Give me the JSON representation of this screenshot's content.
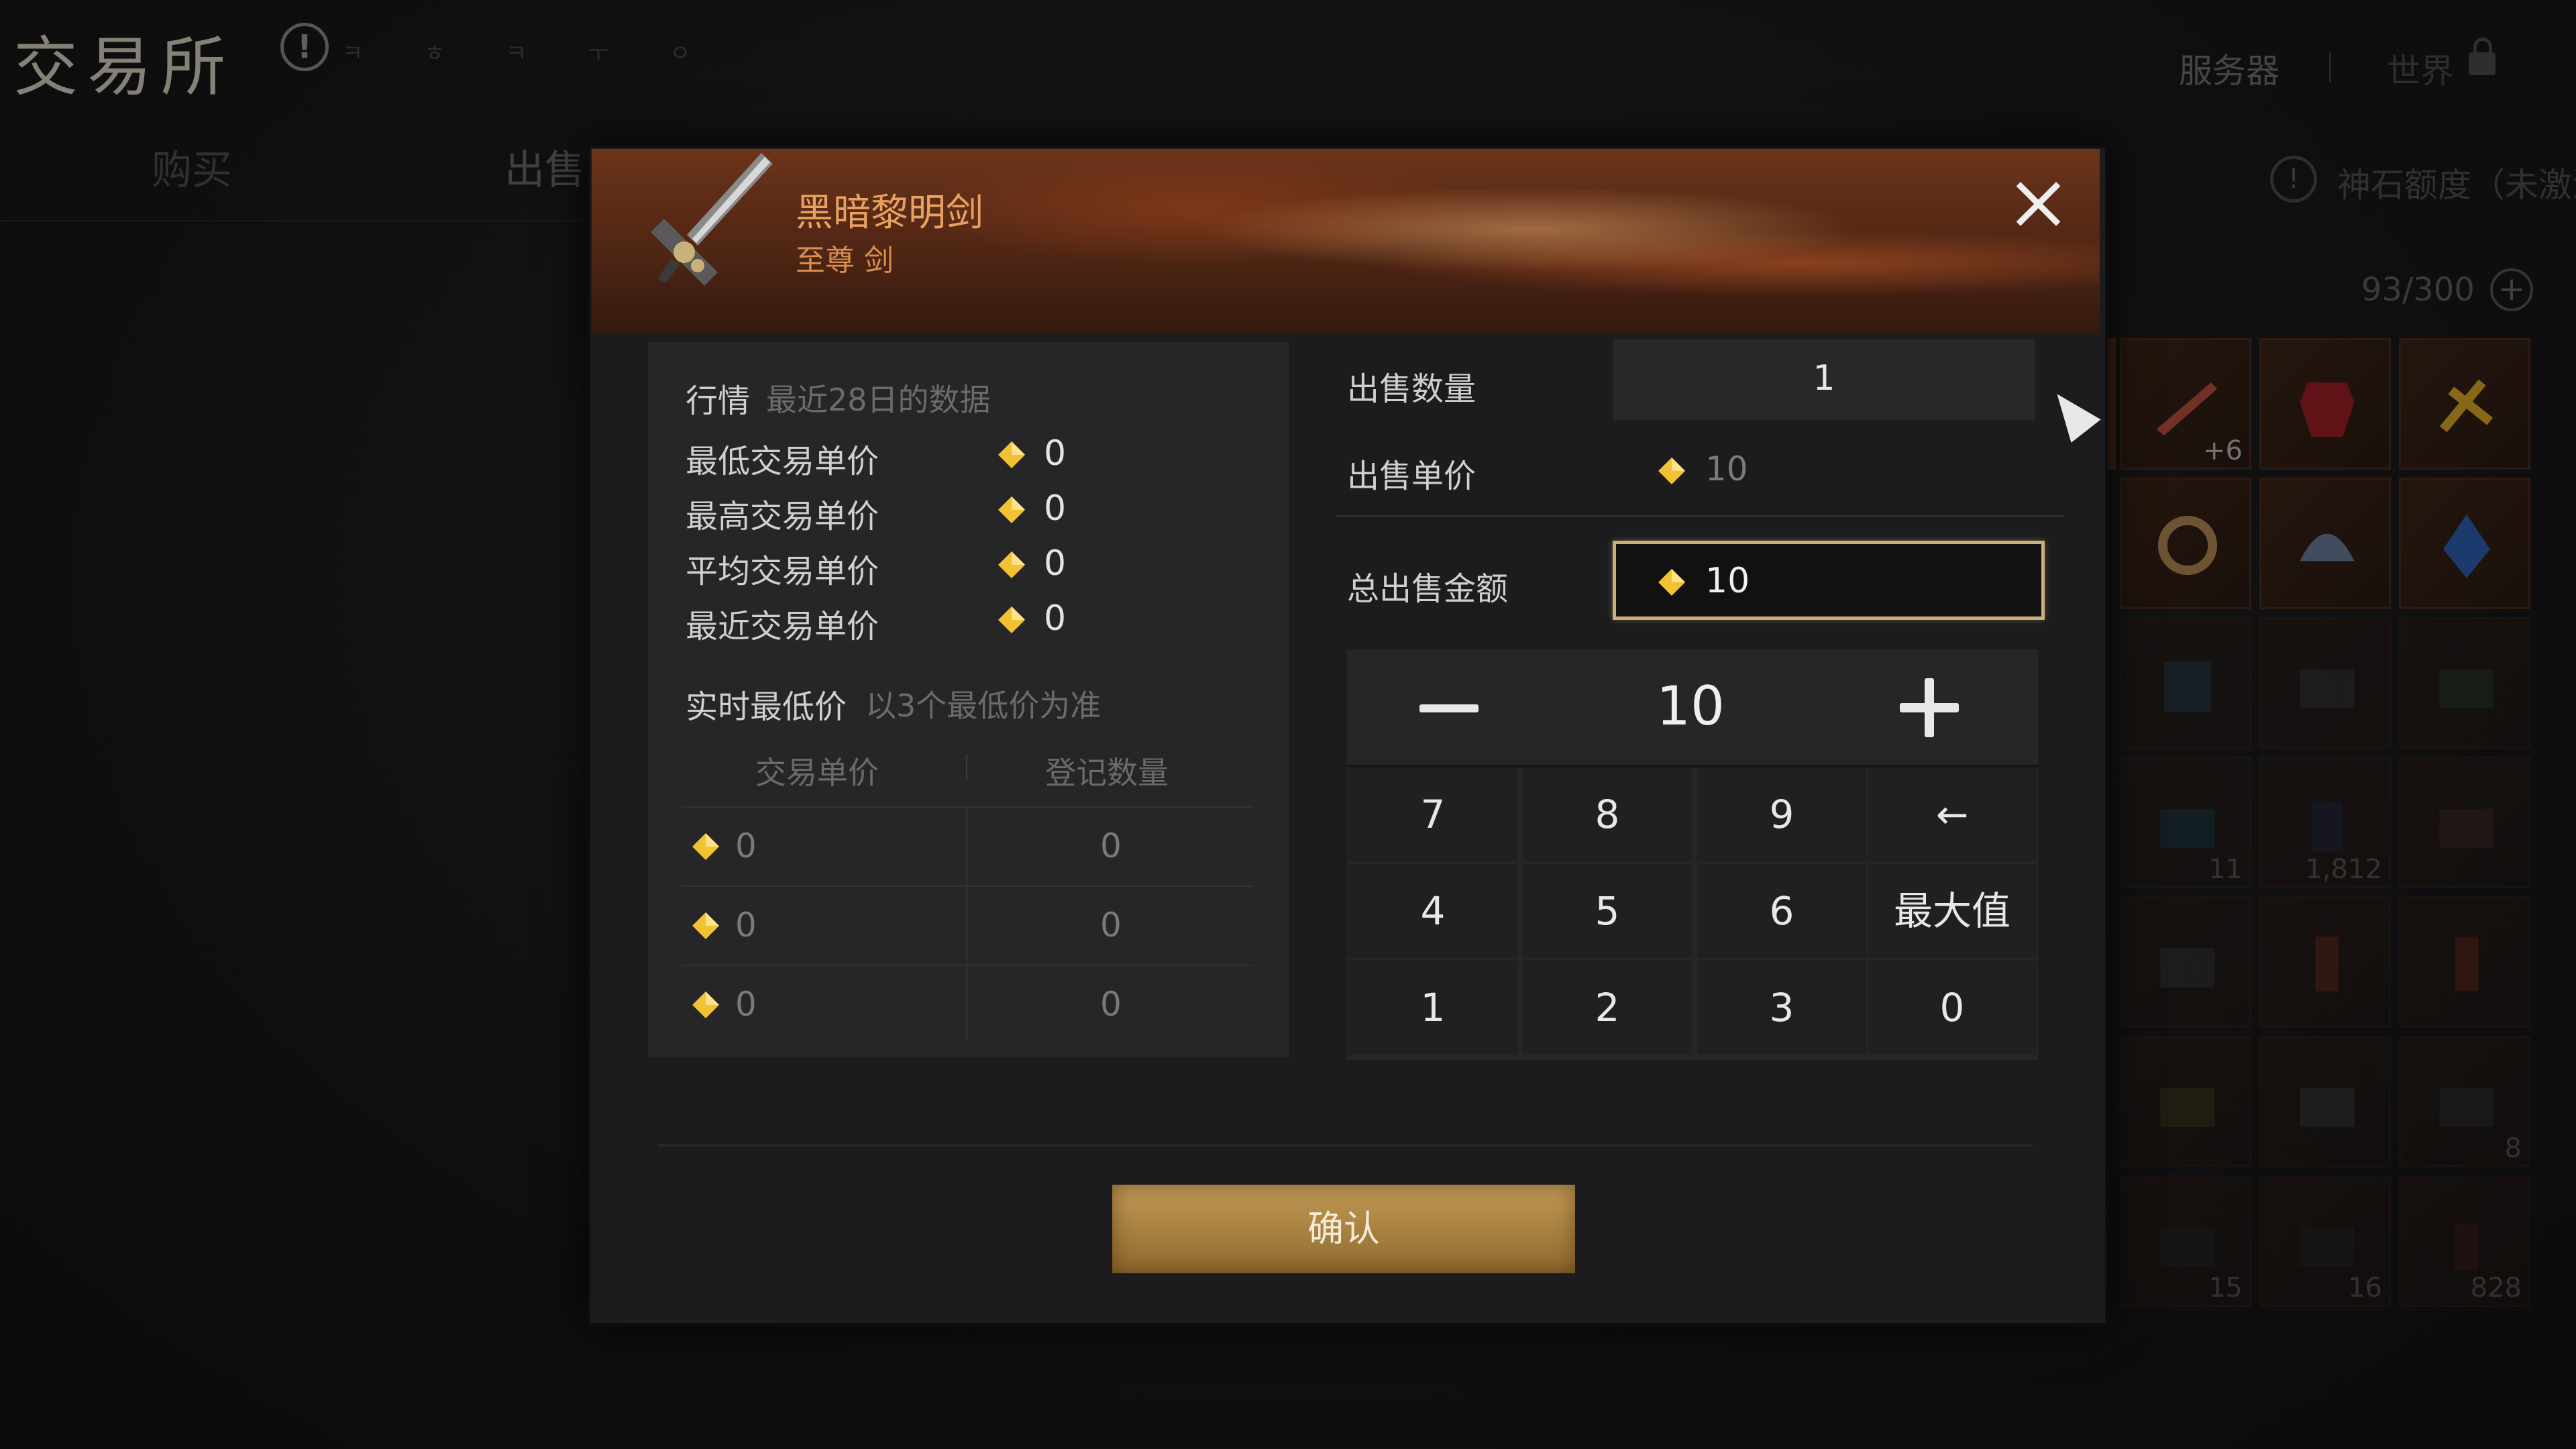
{
  "background": {
    "title": "交易所",
    "hint_text": "ㅋ ㅎ ㅋ ㅜ ㅇ",
    "tabs": {
      "buy": "购买",
      "sell": "出售"
    },
    "header_right": {
      "server": "服务器",
      "world": "世界"
    },
    "shen_quota": "神石额度（未激活",
    "capacity": "93/300",
    "inventory_counts": [
      "+6",
      "",
      "",
      "",
      "",
      "",
      "",
      "",
      "",
      "11",
      "1,812",
      "",
      "",
      "",
      "",
      "",
      "",
      "8",
      "15",
      "16",
      "828"
    ]
  },
  "modal": {
    "item": {
      "name": "黑暗黎明剑",
      "subtitle": "至尊 剑"
    },
    "market": {
      "header": "行情",
      "header_note": "最近28日的数据",
      "rows": [
        {
          "label": "最低交易单价",
          "value": "0"
        },
        {
          "label": "最高交易单价",
          "value": "0"
        },
        {
          "label": "平均交易单价",
          "value": "0"
        },
        {
          "label": "最近交易单价",
          "value": "0"
        }
      ],
      "realtime_title": "实时最低价",
      "realtime_note": "以3个最低价为准",
      "table_headers": [
        "交易单价",
        "登记数量"
      ],
      "table_rows": [
        {
          "price": "0",
          "qty": "0"
        },
        {
          "price": "0",
          "qty": "0"
        },
        {
          "price": "0",
          "qty": "0"
        }
      ]
    },
    "sell": {
      "qty_label": "出售数量",
      "qty_value": "1",
      "unit_price_label": "出售单价",
      "unit_price_value": "10",
      "total_label": "总出售金额",
      "total_value": "10"
    },
    "keypad": {
      "stepper_value": "10",
      "keys": [
        "7",
        "8",
        "9",
        "←",
        "4",
        "5",
        "6",
        "最大值",
        "1",
        "2",
        "3",
        "0"
      ]
    },
    "confirm_label": "确认"
  },
  "colors": {
    "accent_gold": "#c9b07a",
    "header_orange": "#e8a15f",
    "diamond_gold": "#f1c232"
  }
}
